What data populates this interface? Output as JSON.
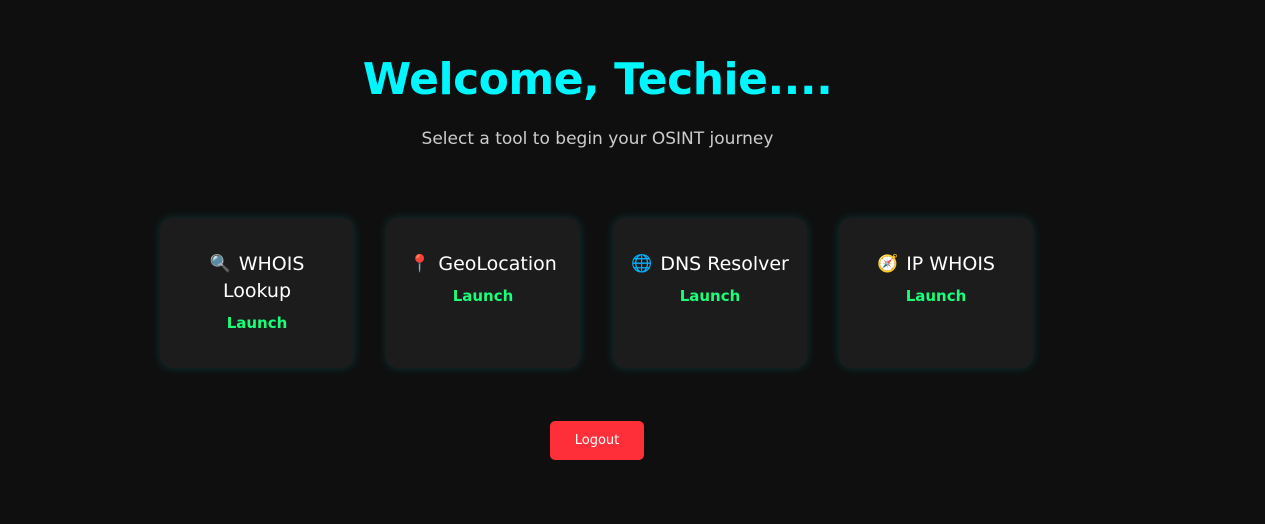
{
  "header": {
    "title": "Welcome, Techie....",
    "subtitle": "Select a tool to begin your OSINT journey"
  },
  "tools": [
    {
      "icon": "🔍",
      "icon_name": "magnifier-icon",
      "label": "WHOIS Lookup",
      "action": "Launch"
    },
    {
      "icon": "📍",
      "icon_name": "pin-icon",
      "label": "GeoLocation",
      "action": "Launch"
    },
    {
      "icon": "🌐",
      "icon_name": "globe-icon",
      "label": "DNS Resolver",
      "action": "Launch"
    },
    {
      "icon": "🧭",
      "icon_name": "compass-icon",
      "label": "IP WHOIS",
      "action": "Launch"
    }
  ],
  "logout": {
    "label": "Logout"
  },
  "colors": {
    "background": "#0f0f0f",
    "title": "#00f7ff",
    "card": "#1c1c1c",
    "launch": "#1aff7a",
    "logout": "#ff2f3a"
  }
}
